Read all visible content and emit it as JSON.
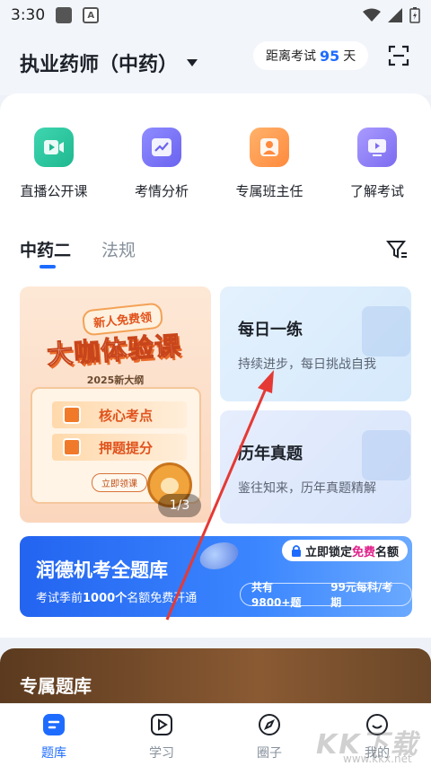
{
  "status_bar": {
    "time": "3:30"
  },
  "header": {
    "title": "执业药师（中药）",
    "countdown_prefix": "距离考试",
    "countdown_days": "95",
    "countdown_suffix": "天"
  },
  "quick_actions": [
    {
      "label": "直播公开课",
      "icon": "video-icon"
    },
    {
      "label": "考情分析",
      "icon": "chart-icon"
    },
    {
      "label": "专属班主任",
      "icon": "teacher-icon"
    },
    {
      "label": "了解考试",
      "icon": "play-screen-icon"
    }
  ],
  "tabs": [
    {
      "label": "中药二",
      "active": true
    },
    {
      "label": "法规",
      "active": false
    }
  ],
  "promo": {
    "tag": "新人免费领",
    "title": "大咖体验课",
    "subtitle": "2025新大纲",
    "item1": "核心考点",
    "item2": "押题提分",
    "button": "立即领课",
    "pager": "1/3"
  },
  "daily": {
    "title": "每日一练",
    "subtitle": "持续进步，每日挑战自我"
  },
  "history": {
    "title": "历年真题",
    "subtitle": "鉴往知来，历年真题精解"
  },
  "banner": {
    "title": "润德机考全题库",
    "sub_prefix": "考试季前",
    "sub_bold": "1000个",
    "sub_suffix": "名额免费开通",
    "lock_prefix": "立即锁定",
    "lock_free": "免费",
    "lock_suffix": "名额",
    "info1": "共有9800+题",
    "info2": "99元每科/考期"
  },
  "exclusive": {
    "title": "专属题库"
  },
  "bottom_nav": [
    {
      "label": "题库",
      "active": true
    },
    {
      "label": "学习",
      "active": false
    },
    {
      "label": "圈子",
      "active": false
    },
    {
      "label": "我的",
      "active": false
    }
  ],
  "watermark": {
    "text": "KK下载",
    "url": "www.kkx.net"
  },
  "colors": {
    "accent": "#1e6cff",
    "arrow": "#e53935"
  }
}
